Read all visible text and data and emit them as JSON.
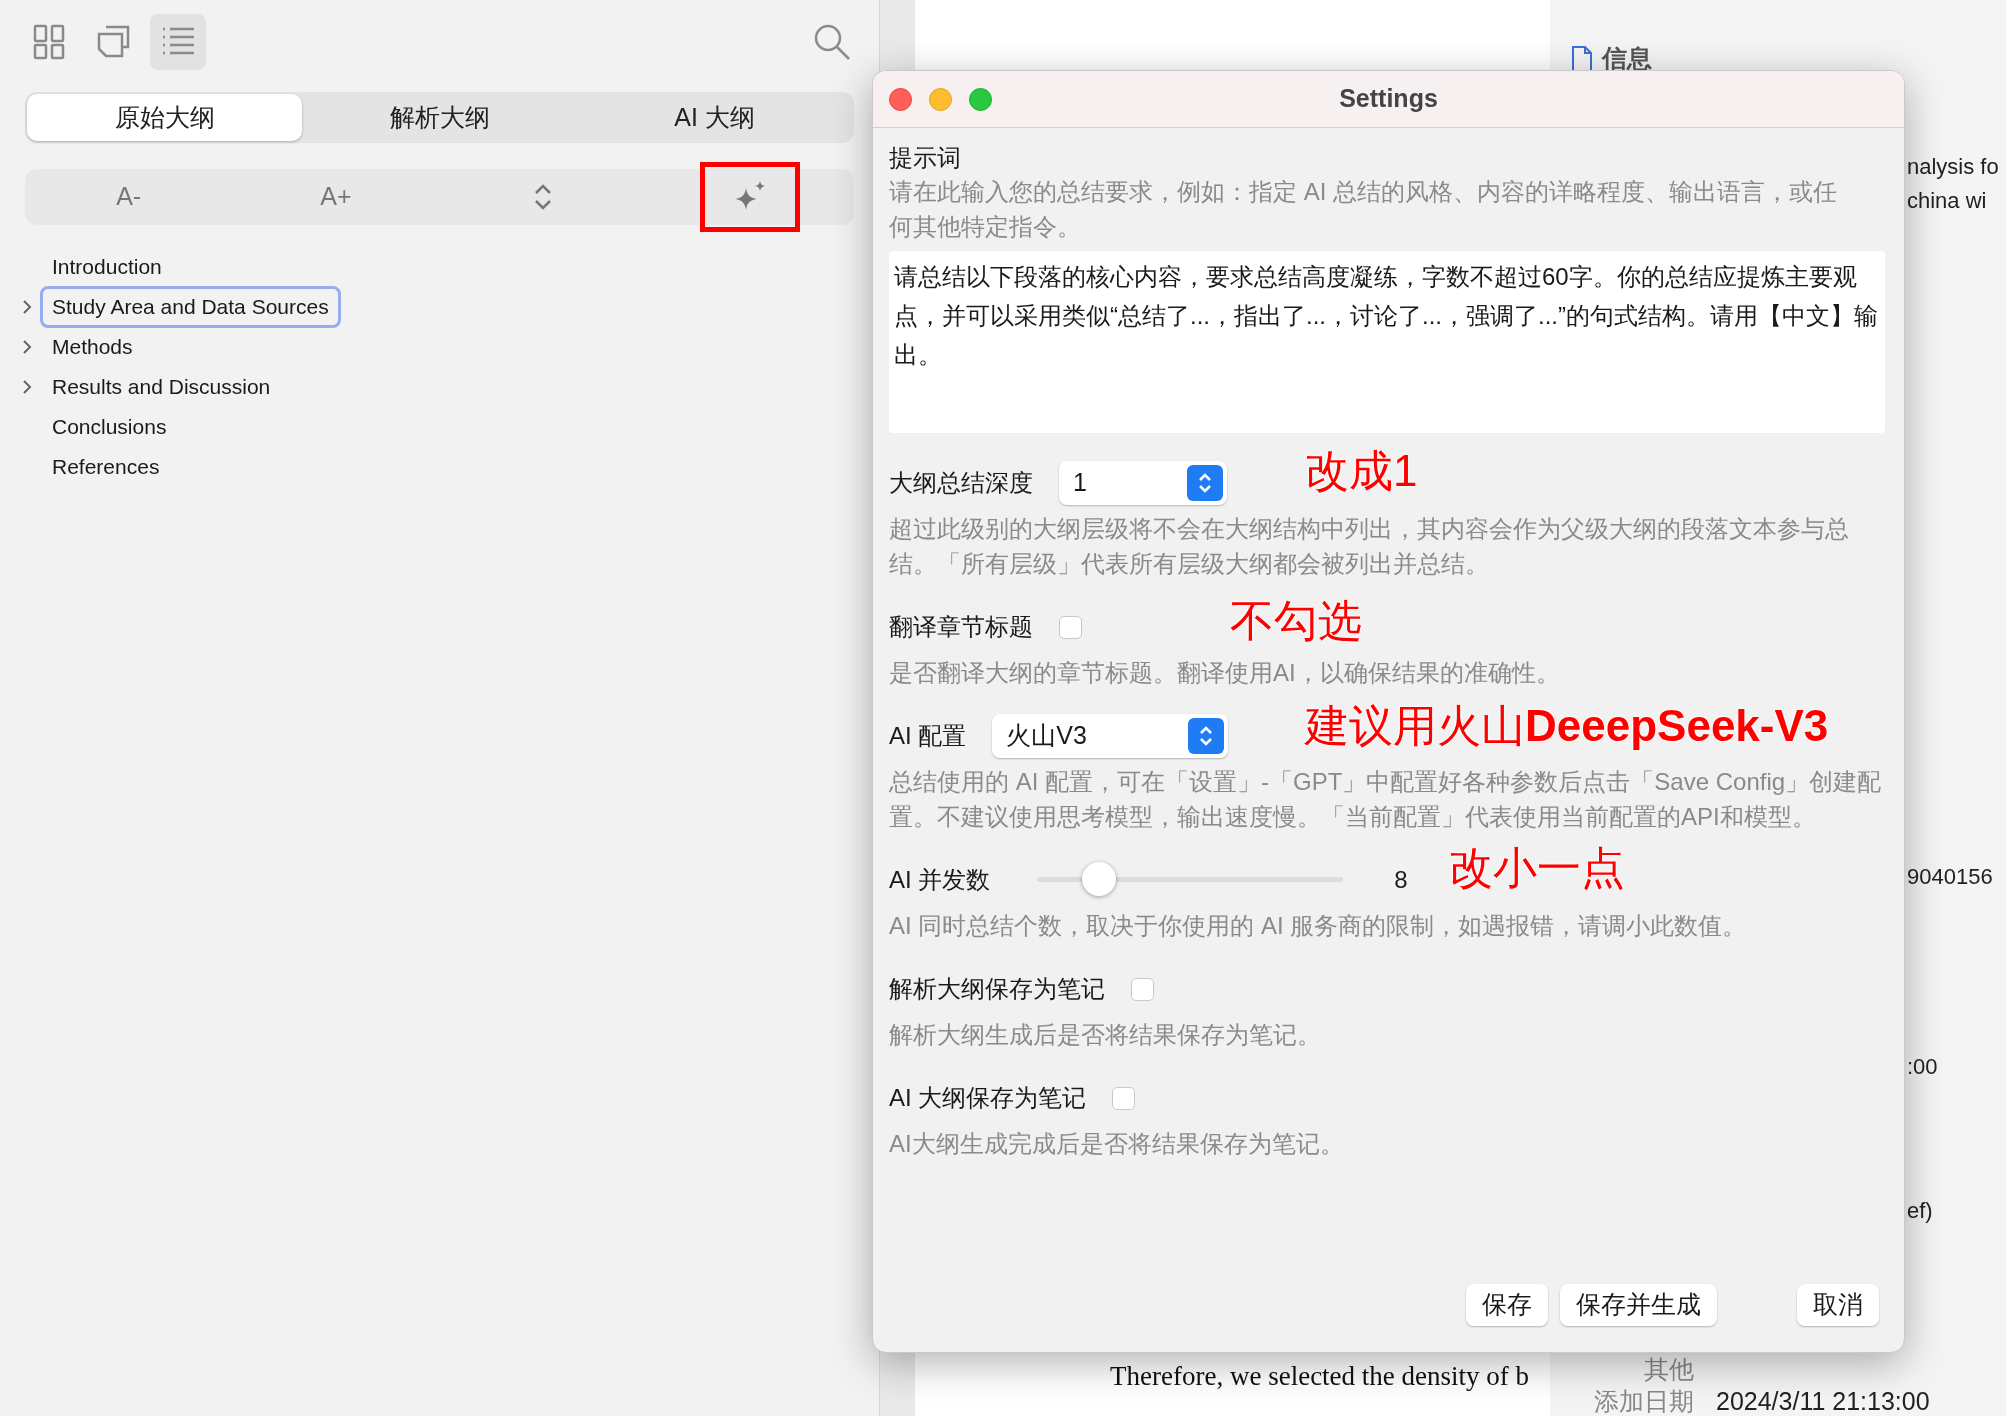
{
  "sidebar": {
    "view_buttons": [
      {
        "kind": "grid",
        "selected": false
      },
      {
        "kind": "cards",
        "selected": false
      },
      {
        "kind": "list",
        "selected": true
      }
    ],
    "tabs": [
      {
        "label": "原始大纲",
        "selected": true
      },
      {
        "label": "解析大纲",
        "selected": false
      },
      {
        "label": "AI 大纲",
        "selected": false
      }
    ],
    "tools": [
      {
        "kind": "text",
        "label": "A-",
        "highlighted": false
      },
      {
        "kind": "text",
        "label": "A+",
        "highlighted": false
      },
      {
        "kind": "expand",
        "highlighted": false
      },
      {
        "kind": "sparkle",
        "highlighted": true
      }
    ],
    "outline": [
      {
        "label": "Introduction",
        "expandable": false,
        "selected": false
      },
      {
        "label": "Study Area and Data Sources",
        "expandable": true,
        "selected": true
      },
      {
        "label": "Methods",
        "expandable": true,
        "selected": false
      },
      {
        "label": "Results and Discussion",
        "expandable": true,
        "selected": false
      },
      {
        "label": "Conclusions",
        "expandable": false,
        "selected": false
      },
      {
        "label": "References",
        "expandable": false,
        "selected": false
      }
    ]
  },
  "document": {
    "lines": [
      "Therefore, we selected the density of b"
    ]
  },
  "info_panel": {
    "title": "信息",
    "fragments": [
      "nalysis fo",
      "china wi",
      "9040156",
      ":00",
      "ef)"
    ],
    "rows": [
      {
        "label": "其他"
      },
      {
        "label": "添加日期",
        "value": "2024/3/11 21:13:00"
      }
    ]
  },
  "dialog": {
    "title": "Settings",
    "prompt": {
      "label": "提示词",
      "hint": "请在此输入您的总结要求，例如：指定 AI 总结的风格、内容的详略程度、输出语言，或任何其他特定指令。",
      "value": "请总结以下段落的核心内容，要求总结高度凝练，字数不超过60字。你的总结应提炼主要观点，并可以采用类似“总结了...，指出了...，讨论了...，强调了...”的句式结构。请用【中文】输出。"
    },
    "settings": [
      {
        "kind": "select",
        "label": "大纲总结深度",
        "value": "1",
        "description": "超过此级别的大纲层级将不会在大纲结构中列出，其内容会作为父级大纲的段落文本参与总结。「所有层级」代表所有层级大纲都会被列出并总结。",
        "annotation": "改成1"
      },
      {
        "kind": "checkbox",
        "label": "翻译章节标题",
        "checked": false,
        "description": "是否翻译大纲的章节标题。翻译使用AI，以确保结果的准确性。",
        "annotation": "不勾选"
      },
      {
        "kind": "select",
        "label": "AI 配置",
        "value": "火山V3",
        "description": "总结使用的 AI 配置，可在「设置」-「GPT」中配置好各种参数后点击「Save Config」创建配置。不建议使用思考模型，输出速度慢。「当前配置」代表使用当前配置的API和模型。",
        "annotation": "建议用火山**DeeepSeek-V3**"
      },
      {
        "kind": "slider",
        "label": "AI 并发数",
        "level": 0.2,
        "reading": "8",
        "description": "AI 同时总结个数，取决于你使用的 AI 服务商的限制，如遇报错，请调小此数值。",
        "annotation": "改小一点"
      },
      {
        "kind": "checkbox",
        "label": "解析大纲保存为笔记",
        "checked": false,
        "description": "解析大纲生成后是否将结果保存为笔记。"
      },
      {
        "kind": "checkbox",
        "label": "AI 大纲保存为笔记",
        "checked": false,
        "description": "AI大纲生成完成后是否将结果保存为笔记。"
      }
    ],
    "buttons": [
      "保存",
      "保存并生成",
      "取消"
    ]
  }
}
